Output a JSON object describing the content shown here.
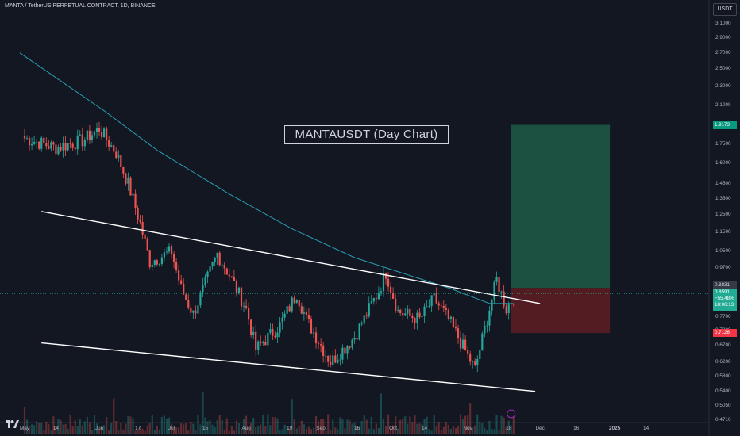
{
  "header": {
    "title": "MANTA / TetherUS PERPETUAL CONTRACT, 1D, BINANCE",
    "currency": "USDT"
  },
  "annotation": "MANTAUSDT (Day Chart)",
  "price_tags": {
    "target": "1.9173",
    "entry": "0.8831",
    "last_price": "0.8591",
    "change": "−55.48%",
    "countdown": "18:06:13",
    "stop": "0.7126"
  },
  "colors": {
    "background": "#131722",
    "up": "#26a69a",
    "down": "#ef5350",
    "ma": "#2a9bb0",
    "trendline": "#ffffff",
    "target_zone": "#1e5a45",
    "stop_zone": "#5a1d22",
    "last_price_tag": "#22ab94",
    "stop_tag": "#f23645",
    "target_tag": "#089981"
  },
  "chart_data": {
    "type": "candlestick",
    "title": "MANTA / TetherUS PERPETUAL CONTRACT, 1D, BINANCE",
    "scale": "log",
    "y_ticks": [
      "3.1000",
      "2.9000",
      "2.7000",
      "2.5000",
      "2.3000",
      "2.1000",
      "1.9000",
      "1.7500",
      "1.6000",
      "1.4500",
      "1.3500",
      "1.2500",
      "1.1500",
      "1.0500",
      "0.9700",
      "0.8900",
      "0.7700",
      "0.7200",
      "0.6700",
      "0.6200",
      "0.5800",
      "0.5400",
      "0.5050",
      "0.4710"
    ],
    "x_ticks": [
      "May",
      "14",
      "Jun",
      "17",
      "Jul",
      "15",
      "Aug",
      "19",
      "Sep",
      "16",
      "Oct",
      "14",
      "Nov",
      "18",
      "Dec",
      "16",
      "2025",
      "14"
    ],
    "close_path": [
      {
        "date": "2024-05-01",
        "price": 1.8
      },
      {
        "date": "2024-05-14",
        "price": 1.72
      },
      {
        "date": "2024-05-25",
        "price": 1.78
      },
      {
        "date": "2024-06-01",
        "price": 1.88
      },
      {
        "date": "2024-06-08",
        "price": 1.68
      },
      {
        "date": "2024-06-13",
        "price": 1.45
      },
      {
        "date": "2024-06-18",
        "price": 1.2
      },
      {
        "date": "2024-06-22",
        "price": 1.0
      },
      {
        "date": "2024-07-01",
        "price": 1.05
      },
      {
        "date": "2024-07-05",
        "price": 0.88
      },
      {
        "date": "2024-07-10",
        "price": 0.78
      },
      {
        "date": "2024-07-15",
        "price": 0.9
      },
      {
        "date": "2024-07-20",
        "price": 1.04
      },
      {
        "date": "2024-07-25",
        "price": 0.94
      },
      {
        "date": "2024-08-01",
        "price": 0.8
      },
      {
        "date": "2024-08-05",
        "price": 0.66
      },
      {
        "date": "2024-08-15",
        "price": 0.74
      },
      {
        "date": "2024-08-22",
        "price": 0.86
      },
      {
        "date": "2024-08-26",
        "price": 0.76
      },
      {
        "date": "2024-09-05",
        "price": 0.62
      },
      {
        "date": "2024-09-15",
        "price": 0.7
      },
      {
        "date": "2024-09-25",
        "price": 0.87
      },
      {
        "date": "2024-09-28",
        "price": 0.95
      },
      {
        "date": "2024-10-03",
        "price": 0.79
      },
      {
        "date": "2024-10-12",
        "price": 0.76
      },
      {
        "date": "2024-10-18",
        "price": 0.84
      },
      {
        "date": "2024-10-24",
        "price": 0.76
      },
      {
        "date": "2024-11-04",
        "price": 0.6
      },
      {
        "date": "2024-11-10",
        "price": 0.8
      },
      {
        "date": "2024-11-13",
        "price": 0.92
      },
      {
        "date": "2024-11-17",
        "price": 0.8
      },
      {
        "date": "2024-11-21",
        "price": 0.86
      }
    ],
    "moving_average": [
      {
        "date": "2024-04-29",
        "price": 2.7
      },
      {
        "date": "2024-06-03",
        "price": 2.05
      },
      {
        "date": "2024-06-25",
        "price": 1.7
      },
      {
        "date": "2024-07-25",
        "price": 1.38
      },
      {
        "date": "2024-08-20",
        "price": 1.17
      },
      {
        "date": "2024-09-15",
        "price": 1.02
      },
      {
        "date": "2024-10-10",
        "price": 0.93
      },
      {
        "date": "2024-10-25",
        "price": 0.88
      },
      {
        "date": "2024-11-10",
        "price": 0.82
      },
      {
        "date": "2024-11-20",
        "price": 0.82
      }
    ],
    "trendlines": [
      {
        "from": {
          "date": "2024-05-08",
          "price": 1.27
        },
        "to": {
          "date": "2024-12-01",
          "price": 0.82
        }
      },
      {
        "from": {
          "date": "2024-05-08",
          "price": 0.68
        },
        "to": {
          "date": "2024-11-29",
          "price": 0.54
        }
      }
    ],
    "position": {
      "type": "long",
      "start_date": "2024-11-19",
      "end_date": "2024-12-30",
      "target": 1.9173,
      "entry": 0.8831,
      "stop": 0.7126
    }
  }
}
